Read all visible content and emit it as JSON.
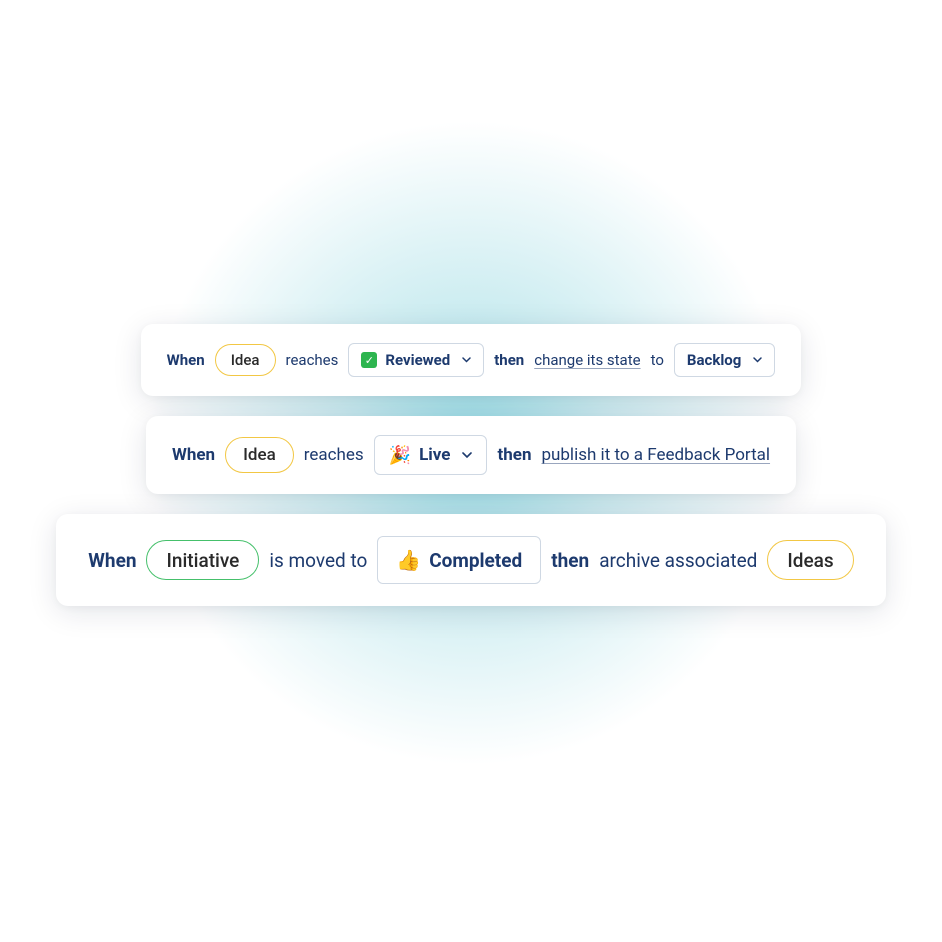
{
  "rules": [
    {
      "when_kw": "When",
      "entity": "Idea",
      "verb": "reaches",
      "status_icon": "check",
      "status_label": "Reviewed",
      "then_kw": "then",
      "action_link": "change its state",
      "action_suffix": "to",
      "target_label": "Backlog"
    },
    {
      "when_kw": "When",
      "entity": "Idea",
      "verb": "reaches",
      "status_emoji": "🎉",
      "status_label": "Live",
      "then_kw": "then",
      "action_link": "publish it to a Feedback Portal"
    },
    {
      "when_kw": "When",
      "entity": "Initiative",
      "verb": "is moved to",
      "status_emoji": "👍",
      "status_label": "Completed",
      "then_kw": "then",
      "action_text": "archive associated",
      "target_pill": "Ideas"
    }
  ]
}
